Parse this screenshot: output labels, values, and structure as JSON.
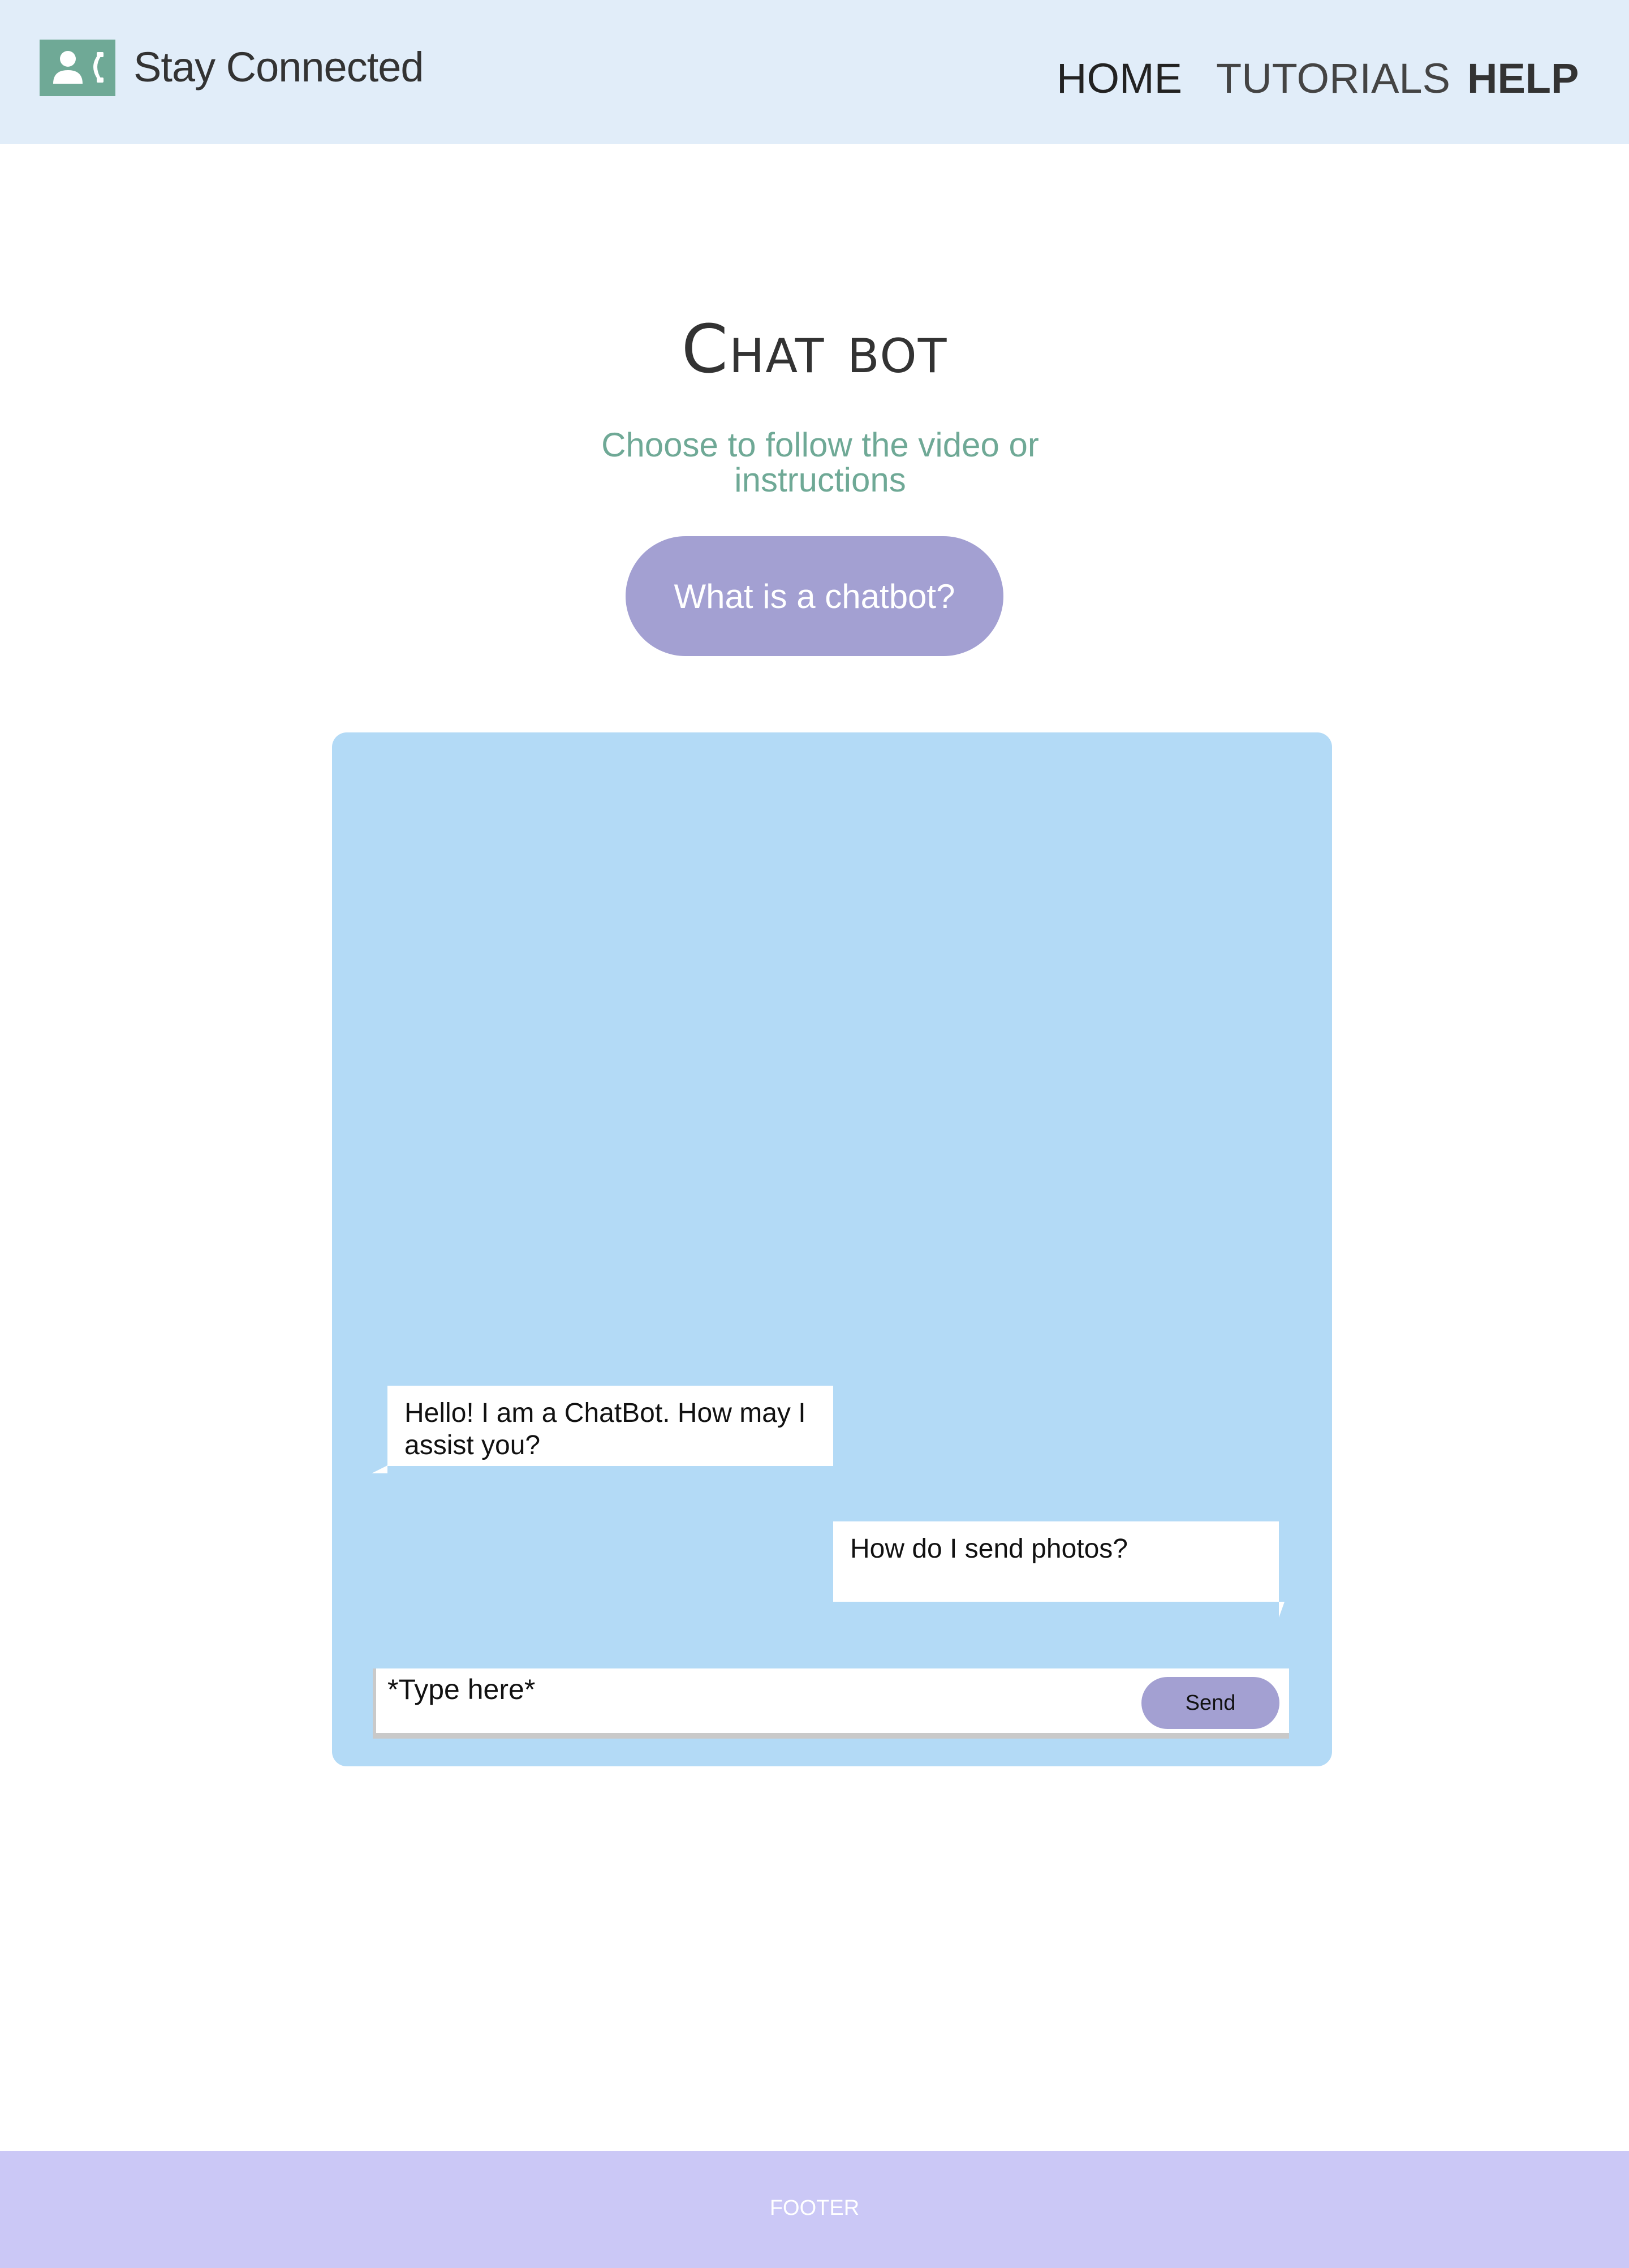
{
  "header": {
    "brand": "Stay Connected",
    "logo_icon": "person-phone-icon",
    "nav": {
      "home": "HOME",
      "tutorials": "TUTORIALS",
      "help": "HELP"
    }
  },
  "main": {
    "title": "Chat bot",
    "subtitle": "Choose to follow the video or instructions",
    "what_button": "What is a chatbot?"
  },
  "chat": {
    "messages": [
      {
        "from": "bot",
        "text": "Hello! I am a ChatBot. How may I assist you?"
      },
      {
        "from": "user",
        "text": "How do I send photos?"
      }
    ],
    "input_value": "*Type here*",
    "send_label": "Send"
  },
  "footer": {
    "text": "FOOTER"
  },
  "colors": {
    "header_bg": "#e1edf9",
    "logo_green": "#6fa996",
    "accent_purple": "#a3a0d2",
    "chat_bg": "#b3daf6",
    "footer_bg": "#cbc8f6"
  }
}
